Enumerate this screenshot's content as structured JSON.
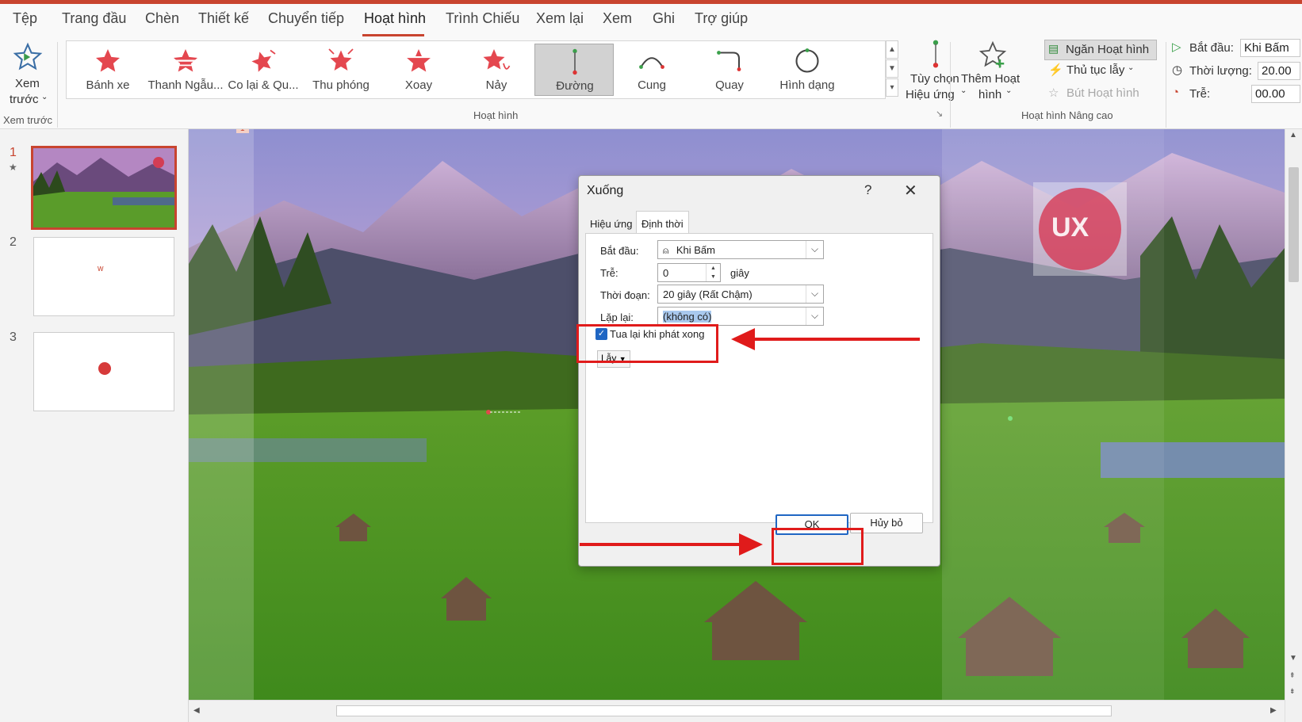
{
  "menu": {
    "tabs": [
      "Tệp",
      "Trang đầu",
      "Chèn",
      "Thiết kế",
      "Chuyển tiếp",
      "Hoạt hình",
      "Trình Chiếu",
      "Xem lại",
      "Xem",
      "Ghi",
      "Trợ giúp"
    ],
    "active_tab": "Hoạt hình"
  },
  "ribbon": {
    "preview_button": {
      "line1": "Xem",
      "line2": "trước"
    },
    "preview_group_label": "Xem trước",
    "animation_group_label": "Hoạt hình",
    "animations": [
      {
        "label": "Bánh xe",
        "icon": "star-wheel-icon"
      },
      {
        "label": "Thanh Ngẫu...",
        "icon": "star-random-bars-icon"
      },
      {
        "label": "Co lại & Qu...",
        "icon": "star-shrink-turn-icon"
      },
      {
        "label": "Thu phóng",
        "icon": "star-zoom-icon"
      },
      {
        "label": "Xoay",
        "icon": "star-swivel-icon"
      },
      {
        "label": "Nảy",
        "icon": "star-bounce-icon"
      },
      {
        "label": "Đường",
        "icon": "line-path-icon"
      },
      {
        "label": "Cung",
        "icon": "arc-path-icon"
      },
      {
        "label": "Quay",
        "icon": "turn-path-icon"
      },
      {
        "label": "Hình dạng",
        "icon": "circle-path-icon"
      }
    ],
    "selected_animation": "Đường",
    "effect_options": {
      "line1": "Tùy chọn",
      "line2": "Hiệu ứng"
    },
    "add_animation": {
      "line1": "Thêm Hoạt",
      "line2": "hình"
    },
    "animation_pane": "Ngăn Hoạt hình",
    "trigger": "Thủ tục lẫy",
    "animation_painter": "Bút Hoạt hình",
    "advanced_group_label": "Hoạt hình Nâng cao",
    "start_label": "Bắt đầu:",
    "start_value": "Khi Bấm",
    "duration_label": "Thời lượng:",
    "duration_value": "20.00",
    "delay_label": "Trễ:",
    "delay_value": "00.00"
  },
  "slides": [
    {
      "number": "1",
      "active": true
    },
    {
      "number": "2",
      "active": false
    },
    {
      "number": "3",
      "active": false
    }
  ],
  "slide_marker": "1",
  "logo_text": "UX",
  "dialog": {
    "title": "Xuống",
    "help": "?",
    "tabs": [
      "Hiệu ứng",
      "Định thời"
    ],
    "active_tab": "Định thời",
    "start_label": "Bắt đầu:",
    "start_value": "Khi Bấm",
    "delay_label": "Trễ:",
    "delay_value": "0",
    "delay_unit": "giây",
    "duration_label": "Thời đoạn:",
    "duration_value": "20 giây (Rất Chậm)",
    "repeat_label": "Lặp lại:",
    "repeat_value": "(không có)",
    "rewind_label": "Tua lại khi phát xong",
    "rewind_checked": true,
    "trigger_button": "Lẫy",
    "ok": "OK",
    "cancel": "Hủy bỏ"
  },
  "colors": {
    "accent": "#c8442f",
    "annotation_red": "#e01b1b",
    "ok_border": "#1f66c3"
  }
}
